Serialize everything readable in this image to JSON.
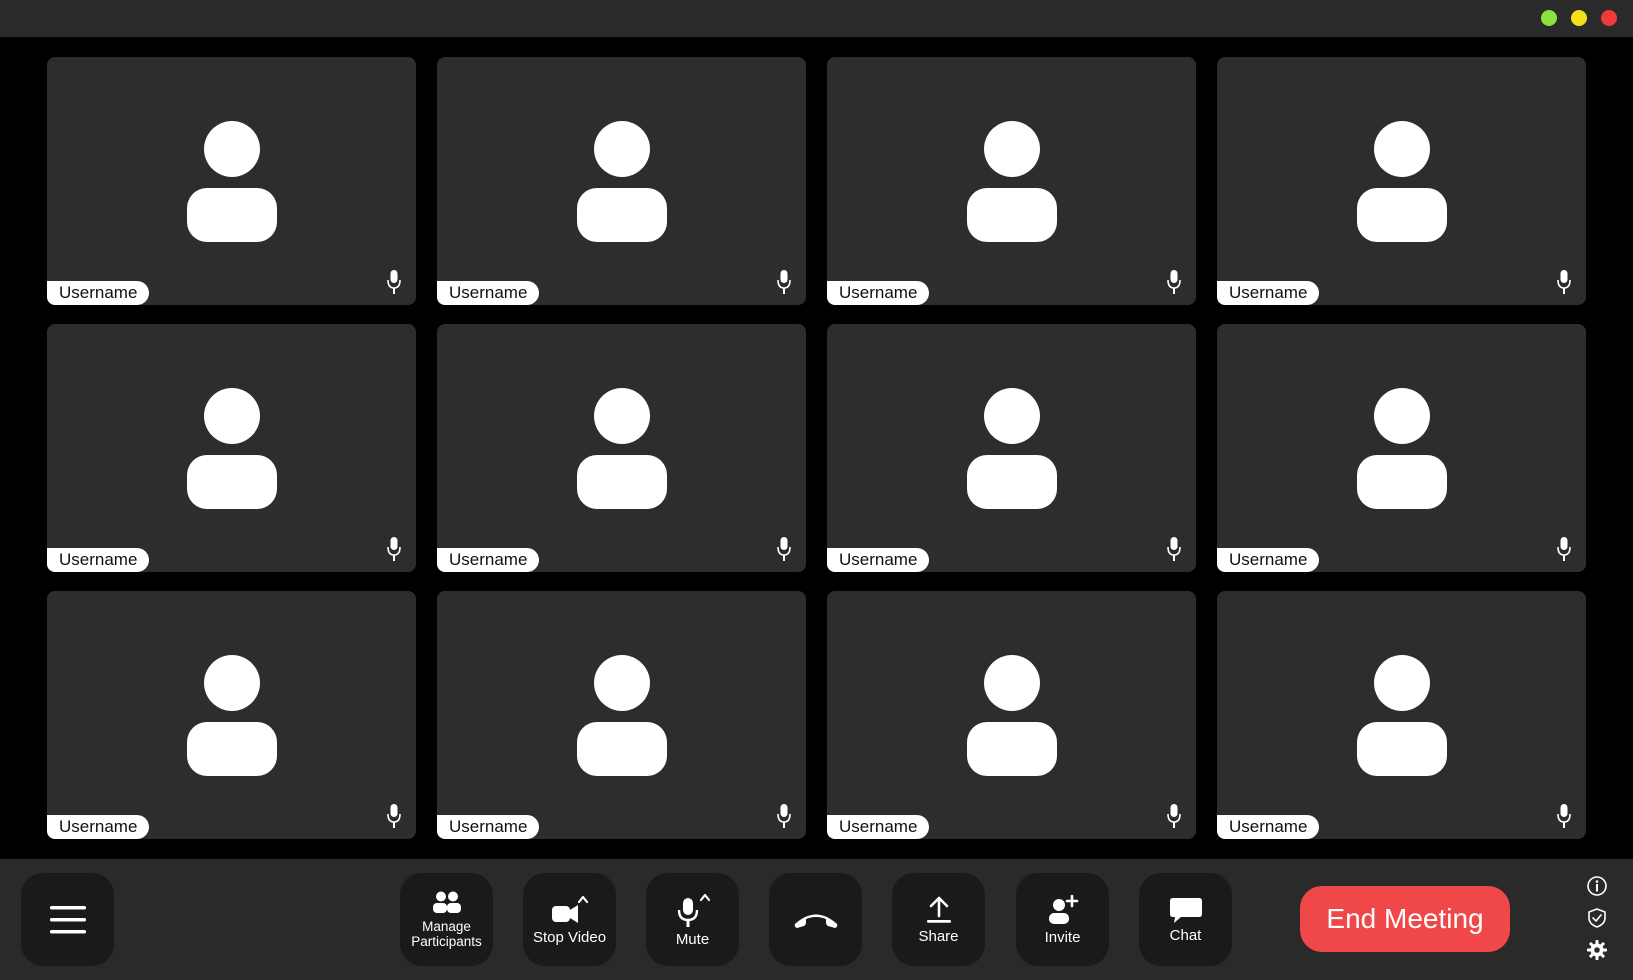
{
  "window": {
    "controls": [
      {
        "name": "green",
        "color": "#8ee03c"
      },
      {
        "name": "yellow",
        "color": "#f2e01d"
      },
      {
        "name": "red",
        "color": "#ee3a3a"
      }
    ]
  },
  "participants": [
    {
      "username": "Username"
    },
    {
      "username": "Username"
    },
    {
      "username": "Username"
    },
    {
      "username": "Username"
    },
    {
      "username": "Username"
    },
    {
      "username": "Username"
    },
    {
      "username": "Username"
    },
    {
      "username": "Username"
    },
    {
      "username": "Username"
    },
    {
      "username": "Username"
    },
    {
      "username": "Username"
    },
    {
      "username": "Username"
    }
  ],
  "toolbar": {
    "menu_icon": "hamburger-menu-icon",
    "manage_participants_label": "Manage\nParticipants",
    "stop_video_label": "Stop Video",
    "mute_label": "Mute",
    "hangup_icon": "phone-hangup-icon",
    "share_label": "Share",
    "invite_label": "Invite",
    "chat_label": "Chat",
    "end_meeting_label": "End Meeting",
    "end_meeting_color": "#f04848"
  },
  "side_icons": [
    "info-icon",
    "shield-icon",
    "gear-icon"
  ]
}
